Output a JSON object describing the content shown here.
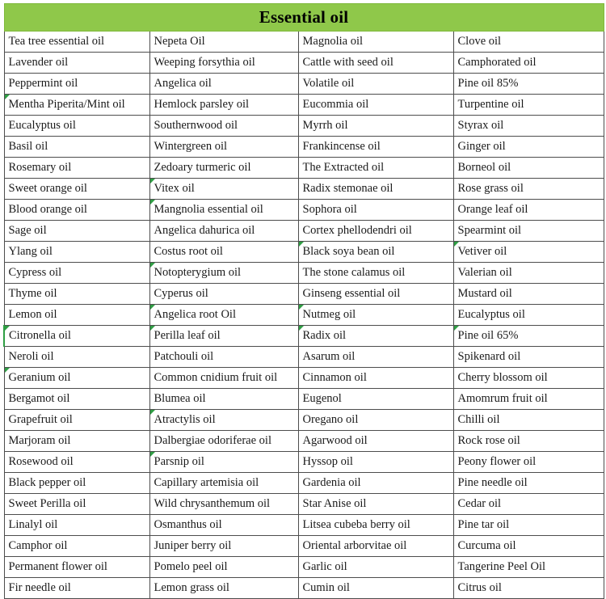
{
  "header": {
    "title": "Essential oil",
    "background_color": "#8fc84a",
    "text_color": "#000000"
  },
  "table": {
    "column_count": 4,
    "row_count": 26,
    "border_color": "#4d4d4d",
    "marker_color": "#2f9e44",
    "rows": [
      [
        "Tea tree essential oil",
        "Nepeta Oil",
        "Magnolia oil",
        "Clove oil"
      ],
      [
        "Lavender oil",
        "Weeping forsythia oil",
        "Cattle with seed oil",
        "Camphorated oil"
      ],
      [
        "Peppermint oil",
        "Angelica oil",
        "Volatile oil",
        "Pine oil 85%"
      ],
      [
        "Mentha Piperita/Mint oil",
        "Hemlock parsley oil",
        "Eucommia oil",
        "Turpentine oil"
      ],
      [
        "Eucalyptus oil",
        "Southernwood oil",
        "Myrrh oil",
        "Styrax oil"
      ],
      [
        "Basil oil",
        "Wintergreen oil",
        "Frankincense oil",
        "Ginger oil"
      ],
      [
        "Rosemary oil",
        "Zedoary turmeric oil",
        "The Extracted oil",
        "Borneol oil"
      ],
      [
        "Sweet orange oil",
        "Vitex oil",
        "Radix stemonae oil",
        "Rose grass oil"
      ],
      [
        "Blood orange oil",
        "Mangnolia essential oil",
        "Sophora oil",
        "Orange leaf oil"
      ],
      [
        "Sage oil",
        "Angelica dahurica oil",
        "Cortex phellodendri oil",
        "Spearmint oil"
      ],
      [
        "Ylang oil",
        "Costus root oil",
        "Black soya bean oil",
        "Vetiver oil"
      ],
      [
        "Cypress oil",
        "Notopterygium oil",
        "The stone calamus oil",
        "Valerian oil"
      ],
      [
        "Thyme oil",
        "Cyperus oil",
        "Ginseng essential oil",
        "Mustard oil"
      ],
      [
        "Lemon oil",
        "Angelica root Oil",
        "Nutmeg oil",
        "Eucalyptus oil"
      ],
      [
        "Citronella oil",
        "Perilla leaf oil",
        "Radix oil",
        "Pine oil 65%"
      ],
      [
        "Neroli oil",
        "Patchouli oil",
        "Asarum oil",
        "Spikenard oil"
      ],
      [
        "Geranium oil",
        "Common cnidium fruit oil",
        "Cinnamon oil",
        "Cherry blossom oil"
      ],
      [
        "Bergamot oil",
        "Blumea oil",
        "Eugenol",
        "Amomrum fruit oil"
      ],
      [
        "Grapefruit oil",
        "Atractylis oil",
        "Oregano oil",
        "Chilli oil"
      ],
      [
        "Marjoram oil",
        "Dalbergiae odoriferae oil",
        "Agarwood oil",
        "Rock rose oil"
      ],
      [
        "Rosewood oil",
        "Parsnip oil",
        "Hyssop oil",
        "Peony flower oil"
      ],
      [
        "Black pepper oil",
        "Capillary artemisia oil",
        "Gardenia oil",
        "Pine needle oil"
      ],
      [
        "Sweet Perilla oil",
        "Wild chrysanthemum oil",
        "Star Anise oil",
        "Cedar oil"
      ],
      [
        "Linalyl oil",
        "Osmanthus oil",
        "Litsea cubeba berry oil",
        "Pine tar oil"
      ],
      [
        "Camphor oil",
        "Juniper berry oil",
        "Oriental arborvitae oil",
        "Curcuma oil"
      ],
      [
        "Permanent flower oil",
        "Pomelo peel oil",
        "Garlic oil",
        "Tangerine Peel Oil"
      ],
      [
        "Fir needle oil",
        "Lemon grass oil",
        "Cumin oil",
        "Citrus oil"
      ]
    ],
    "comment_markers": [
      [
        3,
        0
      ],
      [
        7,
        1
      ],
      [
        8,
        1
      ],
      [
        10,
        3
      ],
      [
        11,
        1
      ],
      [
        13,
        1
      ],
      [
        14,
        0
      ],
      [
        14,
        1
      ],
      [
        14,
        2
      ],
      [
        14,
        3
      ],
      [
        16,
        0
      ],
      [
        18,
        1
      ],
      [
        20,
        1
      ],
      [
        10,
        2
      ],
      [
        13,
        2
      ]
    ]
  }
}
